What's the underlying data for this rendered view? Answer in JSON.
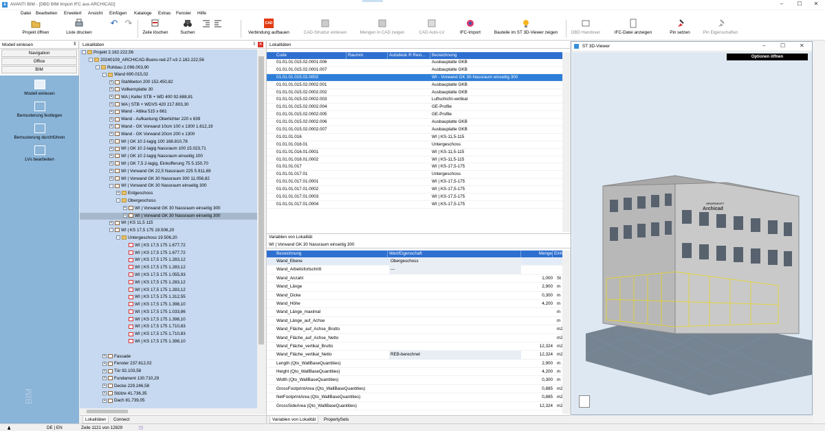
{
  "window": {
    "title": "AVANTI BIM - [DBD BIM Import IFC aus ARCHICAD]",
    "minimize": "–",
    "maximize": "☐",
    "close": "✕"
  },
  "menu": [
    "Datei",
    "Bearbeiten",
    "Erweitert",
    "Ansicht",
    "Einfügen",
    "Kataloge",
    "Extras",
    "Fenster",
    "Hilfe"
  ],
  "toolbar": {
    "projekt_oeffnen": "Projekt öffnen",
    "liste_drucken": "Liste drucken",
    "zeile_loeschen": "Zeile löschen",
    "suchen": "Suchen",
    "verbindung": "Verbindung aufbauen",
    "cad_icon": "CAD",
    "cad_struktur": "CAD-Struktur einlesen",
    "mengen_cad": "Mengen in CAD zeigen",
    "cad_auto_lv": "CAD Auto-LV",
    "ifc_import": "IFC-Import",
    "bauteile_3d": "Bauteile im ST 3D-Viewer zeigen",
    "dbd_handover": "DBD Handover",
    "ifc_datei": "IFC-Datei anzeigen",
    "pin_setzen": "Pin setzen",
    "pin_eigenschaften": "Pin Eigenschaften"
  },
  "left": {
    "header": "Modell einlesen",
    "pin": "⊼",
    "tabs": [
      "Navigation",
      "Office",
      "BIM"
    ],
    "items": [
      {
        "label": "Modell einlesen",
        "icon": "monitor-import-icon"
      },
      {
        "label": "Bemusterung festlegen",
        "icon": "palette-icon"
      },
      {
        "label": "Bemusterung durchführen",
        "icon": "gear-palette-icon"
      },
      {
        "label": "LVs bearbeiten",
        "icon": "document-search-icon"
      }
    ],
    "watermark": "BIM"
  },
  "tree": {
    "header": "Lokalitäten",
    "pin": "⊼",
    "close": "✕",
    "nodes": [
      {
        "t": "Projekt  2.182.222,56",
        "lvl": 0,
        "ex": "-",
        "icon": "folder"
      },
      {
        "t": "20240109_ARCHICAD-Buero-red-27-v3  2.182.222,56",
        "lvl": 1,
        "ex": "-",
        "icon": "folder"
      },
      {
        "t": "Rohbau  2.096.003,90",
        "lvl": 2,
        "ex": "-",
        "icon": "folder"
      },
      {
        "t": "Wand  690.015,02",
        "lvl": 3,
        "ex": "-",
        "icon": "folder"
      },
      {
        "t": "Stahlbeton 200  152.450,82",
        "lvl": 4,
        "ex": "+",
        "icon": "elem"
      },
      {
        "t": "Vollkernplatte 30",
        "lvl": 4,
        "ex": "+",
        "icon": "elem"
      },
      {
        "t": "WA | Keller STB + WD 400  92.688,81",
        "lvl": 4,
        "ex": "+",
        "icon": "elem"
      },
      {
        "t": "WA | STB + WDVS 420  217.803,30",
        "lvl": 4,
        "ex": "+",
        "icon": "elem"
      },
      {
        "t": "Wand - Attika 515 x 661",
        "lvl": 4,
        "ex": "+",
        "icon": "elem"
      },
      {
        "t": "Wand - Aufkantung Oberlichter 220 x 639",
        "lvl": 4,
        "ex": "+",
        "icon": "elem"
      },
      {
        "t": "Wand - GK Vorwand 10cm 100 x 1300  1.612,19",
        "lvl": 4,
        "ex": "+",
        "icon": "elem"
      },
      {
        "t": "Wand - GK Vorwand 20cm 200 x 1300",
        "lvl": 4,
        "ex": "+",
        "icon": "elem"
      },
      {
        "t": "WI | GK 10 2-lagig 100  168.810,78",
        "lvl": 4,
        "ex": "+",
        "icon": "elem"
      },
      {
        "t": "WI | GK 10 2-lagig Nassraum 100  15.023,71",
        "lvl": 4,
        "ex": "+",
        "icon": "elem"
      },
      {
        "t": "WI | GK 10 2-lagig Nassraum einseitig 100",
        "lvl": 4,
        "ex": "+",
        "icon": "elem"
      },
      {
        "t": "WI | GK 7,5 2-lagig, Einkofferung 75  5.150,70",
        "lvl": 4,
        "ex": "+",
        "icon": "elem"
      },
      {
        "t": "WI | Vorwand GK 22,5 Nassraum 225  5.911,69",
        "lvl": 4,
        "ex": "+",
        "icon": "elem"
      },
      {
        "t": "WI | Vorwand GK 30 Nassraum 300  11.056,82",
        "lvl": 4,
        "ex": "+",
        "icon": "elem"
      },
      {
        "t": "WI | Vorwand GK 30 Nassraum einseitig 300",
        "lvl": 4,
        "ex": "-",
        "icon": "elem"
      },
      {
        "t": "Erdgeschoss",
        "lvl": 5,
        "ex": "+",
        "icon": "folder"
      },
      {
        "t": "Obergeschoss",
        "lvl": 5,
        "ex": "-",
        "icon": "folder"
      },
      {
        "t": "WI | Vorwand GK 30 Nassraum einseitig 300",
        "lvl": 6,
        "ex": "+",
        "icon": "elem"
      },
      {
        "t": "WI | Vorwand GK 30 Nassraum einseitig 300",
        "lvl": 6,
        "ex": "+",
        "icon": "elem",
        "sel": true
      },
      {
        "t": "WI | KS 11,5 115",
        "lvl": 4,
        "ex": "+",
        "icon": "elem"
      },
      {
        "t": "WI | KS 17,5 175  19.506,20",
        "lvl": 4,
        "ex": "-",
        "icon": "elem"
      },
      {
        "t": "Untergeschoss  19.506,20",
        "lvl": 5,
        "ex": "-",
        "icon": "folder"
      },
      {
        "t": "WI | KS 17,5 175  1.677,72",
        "lvl": 6,
        "ex": "",
        "icon": "red"
      },
      {
        "t": "WI | KS 17,5 175  1.677,72",
        "lvl": 6,
        "ex": "",
        "icon": "red"
      },
      {
        "t": "WI | KS 17,5 175  1.283,12",
        "lvl": 6,
        "ex": "",
        "icon": "red"
      },
      {
        "t": "WI | KS 17,5 175  1.283,12",
        "lvl": 6,
        "ex": "",
        "icon": "red"
      },
      {
        "t": "WI | KS 17,5 175  1.055,93",
        "lvl": 6,
        "ex": "",
        "icon": "red"
      },
      {
        "t": "WI | KS 17,5 175  1.283,12",
        "lvl": 6,
        "ex": "",
        "icon": "red"
      },
      {
        "t": "WI | KS 17,5 175  1.283,12",
        "lvl": 6,
        "ex": "",
        "icon": "red"
      },
      {
        "t": "WI | KS 17,5 175  1.312,55",
        "lvl": 6,
        "ex": "",
        "icon": "red"
      },
      {
        "t": "WI | KS 17,5 175  1.398,10",
        "lvl": 6,
        "ex": "",
        "icon": "red"
      },
      {
        "t": "WI | KS 17,5 175  1.033,86",
        "lvl": 6,
        "ex": "",
        "icon": "red"
      },
      {
        "t": "WI | KS 17,5 175  1.398,10",
        "lvl": 6,
        "ex": "",
        "icon": "red"
      },
      {
        "t": "WI | KS 17,5 175  1.710,83",
        "lvl": 6,
        "ex": "",
        "icon": "red"
      },
      {
        "t": "WI | KS 17,5 175  1.710,83",
        "lvl": 6,
        "ex": "",
        "icon": "red"
      },
      {
        "t": "WI | KS 17,5 175  1.398,10",
        "lvl": 6,
        "ex": "",
        "icon": "red"
      },
      {
        "t": "",
        "lvl": 6,
        "ex": "",
        "icon": "none"
      },
      {
        "t": "Fassade",
        "lvl": 3,
        "ex": "+",
        "icon": "elem"
      },
      {
        "t": "Fenster  237.612,02",
        "lvl": 3,
        "ex": "+",
        "icon": "elem"
      },
      {
        "t": "Tür  92.103,58",
        "lvl": 3,
        "ex": "+",
        "icon": "elem"
      },
      {
        "t": "Fundament  130.710,29",
        "lvl": 3,
        "ex": "+",
        "icon": "elem"
      },
      {
        "t": "Decke  229.246,58",
        "lvl": 3,
        "ex": "+",
        "icon": "elem"
      },
      {
        "t": "Stütze  41.736,35",
        "lvl": 3,
        "ex": "+",
        "icon": "elem"
      },
      {
        "t": "Dach  81.739,05",
        "lvl": 3,
        "ex": "+",
        "icon": "elem"
      }
    ],
    "bottom_tabs": [
      "Lokalitäten",
      "Connect"
    ]
  },
  "mid": {
    "header": "Lokalitäten",
    "columns": [
      "Code",
      "Raumnr.",
      "Autodesk ® Revi...",
      "Bezeichnung"
    ],
    "rows": [
      {
        "code": "01.01.01.015.02.0001.006",
        "bez": "Ausbauplatte GKB"
      },
      {
        "code": "01.01.01.015.02.0001.007",
        "bez": "Ausbauplatte GKB"
      },
      {
        "code": "01.01.01.015.02.0002",
        "bez": "WI - Vorwand GK 30-Nassraum einseitig 300",
        "sel": true
      },
      {
        "code": "01.01.01.015.02.0002.001",
        "bez": "Ausbauplatte GKB"
      },
      {
        "code": "01.01.01.015.02.0002.002",
        "bez": "Ausbauplatte GKB"
      },
      {
        "code": "01.01.01.015.02.0002.003",
        "bez": "Luftschicht-vertikal"
      },
      {
        "code": "01.01.01.015.02.0002.004",
        "bez": "GE-Profile"
      },
      {
        "code": "01.01.01.015.02.0002.005",
        "bez": "GE-Profile"
      },
      {
        "code": "01.01.01.015.02.0002.006",
        "bez": "Ausbauplatte GKB"
      },
      {
        "code": "01.01.01.015.02.0002.007",
        "bez": "Ausbauplatte GKB"
      },
      {
        "code": "01.01.01.016",
        "bez": "WI | KS-11,5-115"
      },
      {
        "code": "01.01.01.016.01",
        "bez": "Untergeschoss"
      },
      {
        "code": "01.01.01.016.01.0001",
        "bez": "WI | KS-11,5-115"
      },
      {
        "code": "01.01.01.016.01.0002",
        "bez": "WI | KS-11,5-115"
      },
      {
        "code": "01.01.01.017",
        "bez": "WI | KS-17,5-175"
      },
      {
        "code": "01.01.01.017.01",
        "bez": "Untergeschoss"
      },
      {
        "code": "01.01.01.017.01.0001",
        "bez": "WI | KS-17,5-175"
      },
      {
        "code": "01.01.01.017.01.0002",
        "bez": "WI | KS-17,5-175"
      },
      {
        "code": "01.01.01.017.01.0003",
        "bez": "WI | KS-17,5-175"
      },
      {
        "code": "01.01.01.017.01.0004",
        "bez": "WI | KS-17,5-175"
      }
    ],
    "sub_header": "Variablen von Lokalität",
    "sub_title": "WI | Vorwand GK 30 Nassraum einseitig 300",
    "prop_columns": [
      "Bezeichnung",
      "Wert/Eigenschaft",
      "Menge",
      "Einh..."
    ],
    "props": [
      {
        "n": "Wand_Ebene",
        "v": "Obergeschoss",
        "m": "",
        "e": "",
        "sel": true
      },
      {
        "n": "Wand_Arbeitsfortschritt",
        "v": "---",
        "m": "",
        "e": ""
      },
      {
        "n": "Wand_Anzahl",
        "v": "",
        "m": "1,000",
        "e": "St"
      },
      {
        "n": "Wand_Länge",
        "v": "",
        "m": "2,900",
        "e": "m"
      },
      {
        "n": "Wand_Dicke",
        "v": "",
        "m": "0,300",
        "e": "m"
      },
      {
        "n": "Wand_Höhe",
        "v": "",
        "m": "4,200",
        "e": "m"
      },
      {
        "n": "Wand_Länge_maximal",
        "v": "",
        "m": "",
        "e": "m"
      },
      {
        "n": "Wand_Länge_auf_Achse",
        "v": "",
        "m": "",
        "e": "m"
      },
      {
        "n": "Wand_Fläche_auf_Achse_Brutto",
        "v": "",
        "m": "",
        "e": "m2"
      },
      {
        "n": "Wand_Fläche_auf_Achse_Netto",
        "v": "",
        "m": "",
        "e": "m2"
      },
      {
        "n": "Wand_Fläche_vertikal_Brutto",
        "v": "",
        "m": "12,324",
        "e": "m2"
      },
      {
        "n": "Wand_Fläche_vertikal_Netto",
        "v": "REB-berechnet",
        "m": "12,324",
        "e": "m2"
      },
      {
        "n": "Length (Qto_WallBaseQuantities)",
        "v": "",
        "m": "2,900",
        "e": "m"
      },
      {
        "n": "Height (Qto_WallBaseQuantities)",
        "v": "",
        "m": "4,200",
        "e": "m"
      },
      {
        "n": "Width (Qto_WallBaseQuantities)",
        "v": "",
        "m": "0,300",
        "e": "m"
      },
      {
        "n": "GrossFootprintArea (Qto_WallBaseQuantities)",
        "v": "",
        "m": "0,885",
        "e": "m2"
      },
      {
        "n": "NetFootprintArea (Qto_WallBaseQuantities)",
        "v": "",
        "m": "0,885",
        "e": "m2"
      },
      {
        "n": "GrossSideArea (Qto_WallBaseQuantities)",
        "v": "",
        "m": "12,324",
        "e": "m2"
      }
    ],
    "bottom_tabs": [
      "Variablen von Lokalität",
      "PropertySets"
    ]
  },
  "viewer": {
    "title": "ST 3D-Viewer",
    "options": "Optionen öffnen",
    "minimize": "–",
    "maximize": "☐",
    "close": "✕",
    "logo_line1": "GRAPHISOFT",
    "logo_line2": "Archicad"
  },
  "status": {
    "lang": "DE | EN",
    "rows": "Zeile 1121 von 12829"
  }
}
